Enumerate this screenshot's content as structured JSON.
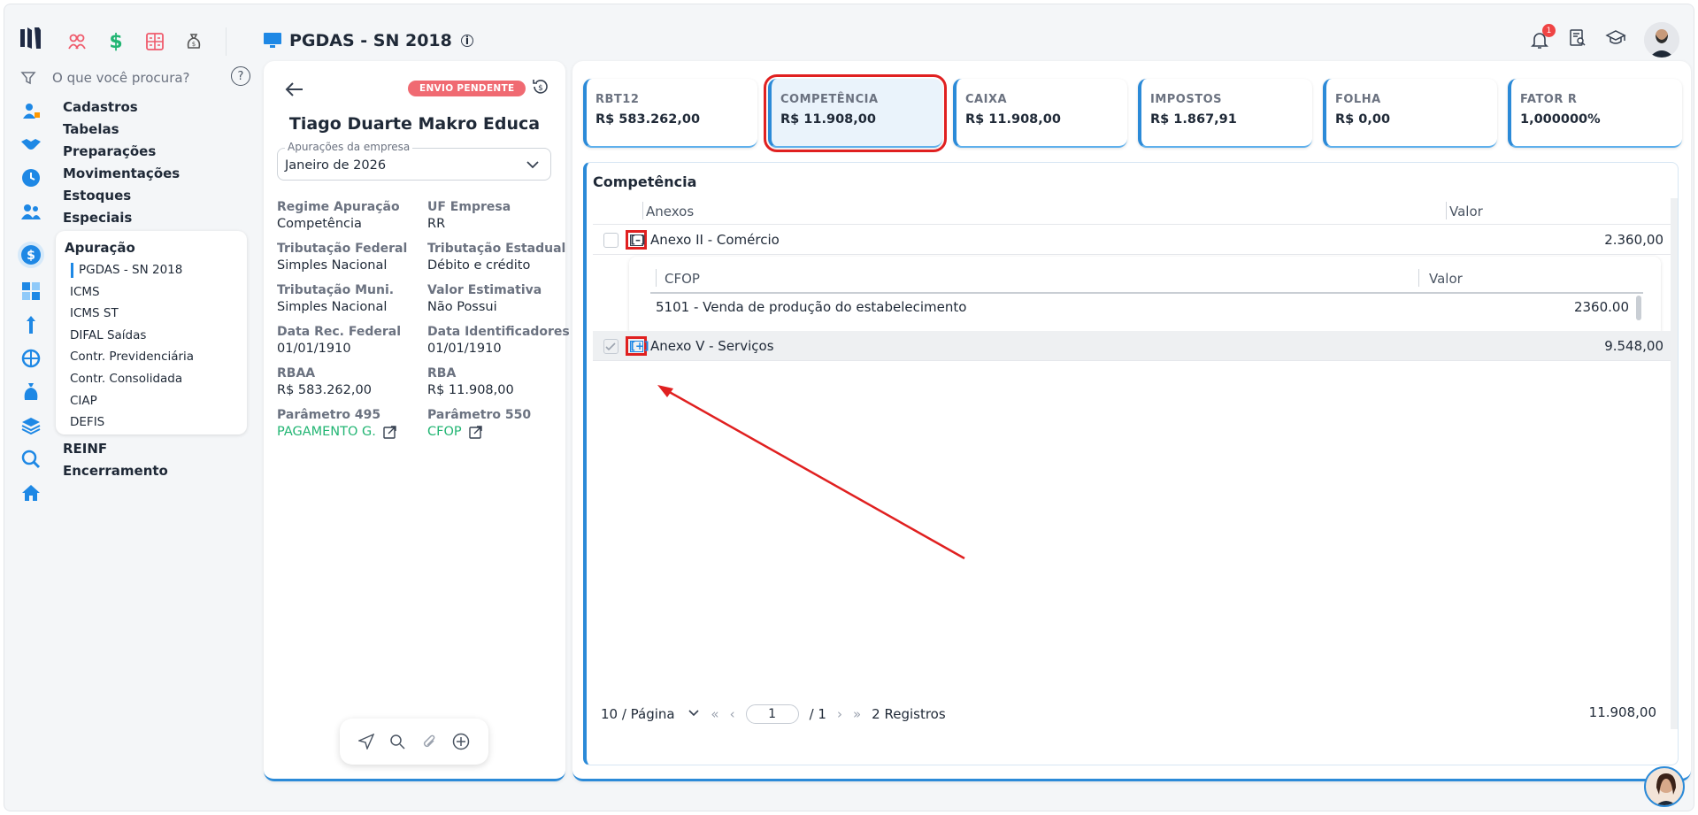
{
  "app": {
    "title": "PGDAS - SN 2018",
    "notifications_count": "1"
  },
  "search": {
    "placeholder": "O que você procura?"
  },
  "sidebar": {
    "items": [
      "Cadastros",
      "Tabelas",
      "Preparações",
      "Movimentações",
      "Estoques",
      "Especiais"
    ],
    "submenu": {
      "title": "Apuração",
      "items": [
        "PGDAS - SN 2018",
        "ICMS",
        "ICMS ST",
        "DIFAL Saídas",
        "Contr. Previdenciária",
        "Contr. Consolidada",
        "CIAP",
        "DEFIS"
      ]
    },
    "items_after": [
      "REINF",
      "Encerramento"
    ]
  },
  "left_panel": {
    "status_badge": "ENVIO PENDENTE",
    "company_name": "Tiago Duarte Makro Educa",
    "select": {
      "label": "Apurações da empresa",
      "value": "Janeiro de 2026"
    },
    "fields": [
      {
        "label": "Regime Apuração",
        "value": "Competência"
      },
      {
        "label": "UF Empresa",
        "value": "RR"
      },
      {
        "label": "Tributação Federal",
        "value": "Simples Nacional"
      },
      {
        "label": "Tributação Estadual",
        "value": "Débito e crédito"
      },
      {
        "label": "Tributação Muni.",
        "value": "Simples Nacional"
      },
      {
        "label": "Valor Estimativa",
        "value": "Não Possui"
      },
      {
        "label": "Data Rec. Federal",
        "value": "01/01/1910"
      },
      {
        "label": "Data Identificadores",
        "value": "01/01/1910"
      },
      {
        "label": "RBAA",
        "value": "R$ 583.262,00"
      },
      {
        "label": "RBA",
        "value": "R$ 11.908,00"
      },
      {
        "label": "Parâmetro 495",
        "value": "PAGAMENTO G."
      },
      {
        "label": "Parâmetro 550",
        "value": "CFOP"
      }
    ]
  },
  "cards": [
    {
      "title": "RBT12",
      "value": "R$ 583.262,00"
    },
    {
      "title": "COMPETÊNCIA",
      "value": "R$ 11.908,00"
    },
    {
      "title": "CAIXA",
      "value": "R$ 11.908,00"
    },
    {
      "title": "IMPOSTOS",
      "value": "R$ 1.867,91"
    },
    {
      "title": "FOLHA",
      "value": "R$ 0,00"
    },
    {
      "title": "FATOR R",
      "value": "1,000000%"
    }
  ],
  "competencia": {
    "title": "Competência",
    "columns": [
      "Anexos",
      "Valor"
    ],
    "rows": [
      {
        "name": "Anexo II - Comércio",
        "value": "2.360,00",
        "expander": "[–]"
      },
      {
        "name": "Anexo V - Serviços",
        "value": "9.548,00",
        "expander": "[+]"
      }
    ],
    "nested": {
      "columns": [
        "CFOP",
        "Valor"
      ],
      "rows": [
        {
          "cfop": "5101 - Venda de produção do estabelecimento",
          "value": "2360.00"
        }
      ]
    },
    "pager": {
      "per_page": "10 / Página",
      "page": "1",
      "of": "/ 1",
      "records": "2 Registros"
    },
    "total": "11.908,00"
  },
  "colors": {
    "accent": "#2b8ad8",
    "highlight": "#e02020",
    "badge": "#f06a72",
    "link": "#22b573"
  }
}
